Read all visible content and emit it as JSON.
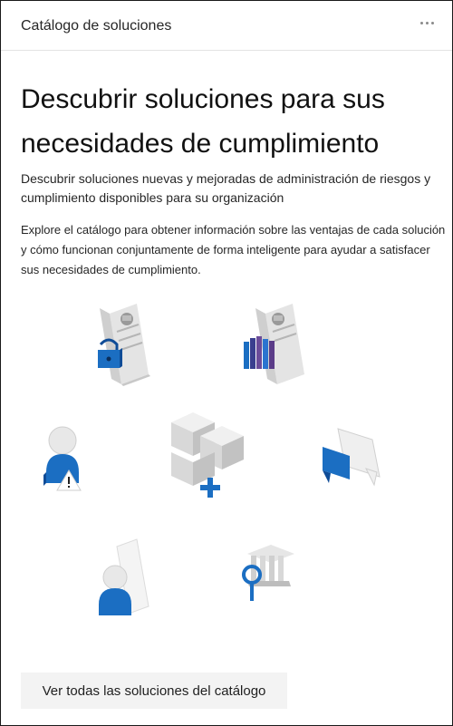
{
  "card": {
    "title": "Catálogo de soluciones",
    "more_icon": "ellipsis-icon"
  },
  "hero": {
    "title": "Descubrir soluciones para sus necesidades de cumplimiento",
    "subtitle": "Descubrir soluciones nuevas y mejoradas de administración de riesgos y cumplimiento disponibles para su organización",
    "description": "Explore el catálogo para obtener información sobre las ventajas de cada solución y cómo funcionan conjuntamente de forma inteligente para ayudar a satisfacer sus necesidades de cumplimiento."
  },
  "illustration": {
    "icons": [
      "document-lock-icon",
      "document-books-icon",
      "person-warning-icon",
      "cubes-plus-icon",
      "chat-bubbles-icon",
      "person-document-icon",
      "building-search-icon"
    ],
    "accent_blue": "#1b6ec2",
    "dark_blue": "#0f4c97"
  },
  "cta": {
    "label": "Ver todas las soluciones del catálogo"
  }
}
